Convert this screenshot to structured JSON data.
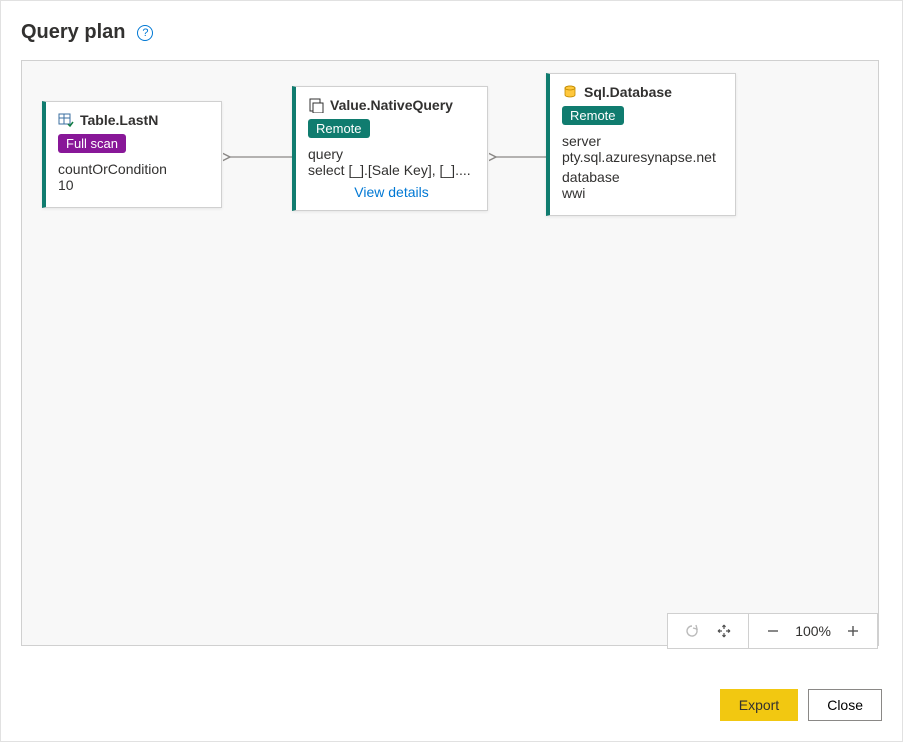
{
  "header": {
    "title": "Query plan",
    "help_char": "?"
  },
  "nodes": {
    "node1": {
      "title": "Table.LastN",
      "badge": "Full scan",
      "param_label": "countOrCondition",
      "param_value": "10"
    },
    "node2": {
      "title": "Value.NativeQuery",
      "badge": "Remote",
      "param_label": "query",
      "param_value": "select [_].[Sale Key], [_]....",
      "view_details": "View details"
    },
    "node3": {
      "title": "Sql.Database",
      "badge": "Remote",
      "server_label": "server",
      "server_value": "pty.sql.azuresynapse.net",
      "db_label": "database",
      "db_value": "wwi"
    }
  },
  "zoom": {
    "level": "100%"
  },
  "footer": {
    "export": "Export",
    "close": "Close"
  }
}
